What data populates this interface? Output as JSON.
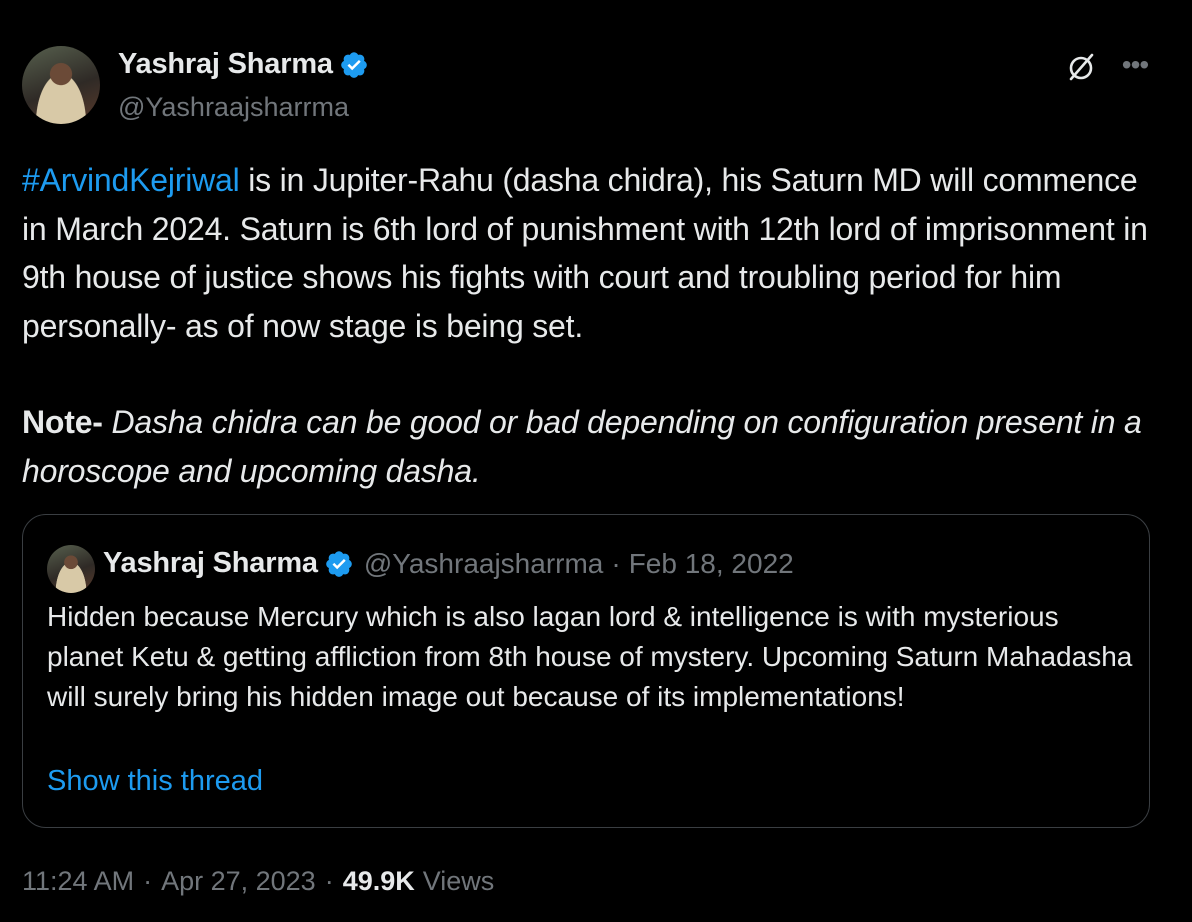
{
  "author": {
    "name": "Yashraj Sharma",
    "handle": "@Yashraajsharrma",
    "verified_icon": "verified-badge-icon",
    "verified_color": "#1d9bf0"
  },
  "tweet": {
    "hashtag": "#ArvindKejriwal",
    "body_line1": " is in Jupiter-Rahu (dasha chidra), his Saturn MD will commence in March 2024. Saturn is 6th lord of punishment with 12th lord of imprisonment in 9th house of justice shows his fights with court and troubling period for him personally- as of now stage is being set.",
    "note_label": "Note-",
    "note_text": " Dasha chidra can be good or bad depending on configuration present in a horoscope and upcoming dasha."
  },
  "quote": {
    "name": "Yashraj Sharma",
    "handle": "@Yashraajsharrma",
    "separator": "·",
    "date": "Feb 18, 2022",
    "text": "Hidden because Mercury which is also lagan lord & intelligence is with mysterious planet Ketu & getting affliction from 8th house of mystery. Upcoming Saturn Mahadasha will surely bring his hidden image out because of its implementations!",
    "show_thread": "Show this thread"
  },
  "meta": {
    "time": "11:24 AM",
    "separator": "·",
    "date": "Apr 27, 2023",
    "views_count": "49.9K",
    "views_label": "Views"
  },
  "icons": {
    "grok": "grok-icon",
    "more": "more-options-icon"
  },
  "colors": {
    "background": "#000000",
    "text": "#e7e9ea",
    "secondary": "#71767b",
    "accent": "#1d9bf0",
    "border": "#3a3e42"
  }
}
